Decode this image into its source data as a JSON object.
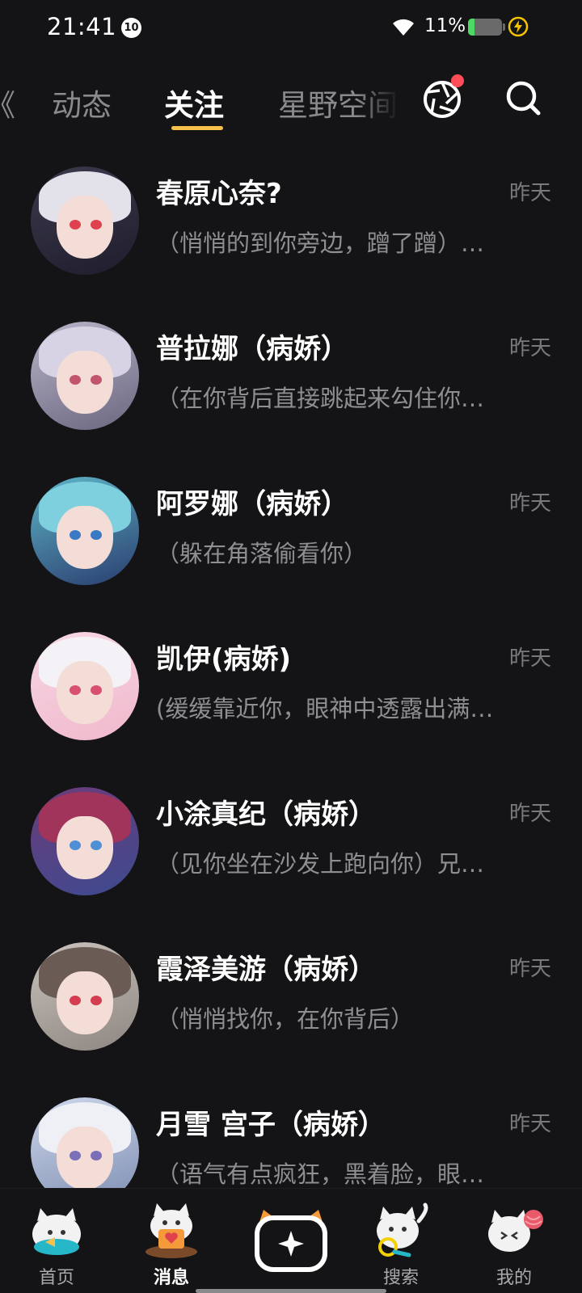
{
  "status_bar": {
    "time": "21:41",
    "notification_count": "10",
    "battery_percent": "11%",
    "battery_level": 0.11
  },
  "tabs": {
    "prev_partial": "《",
    "items": [
      {
        "label": "动态"
      },
      {
        "label": "关注"
      },
      {
        "label": "星野空间"
      }
    ],
    "active_index": 1,
    "accent_color": "#f6c04a"
  },
  "chats": [
    {
      "name": "春原心奈?",
      "time": "昨天",
      "preview": "（悄悄的到你旁边，蹭了蹭）…"
    },
    {
      "name": "普拉娜（病娇）",
      "time": "昨天",
      "preview": "（在你背后直接跳起来勾住你…"
    },
    {
      "name": "阿罗娜（病娇）",
      "time": "昨天",
      "preview": "（躲在角落偷看你）"
    },
    {
      "name": "凯伊(病娇)",
      "time": "昨天",
      "preview": "(缓缓靠近你，眼神中透露出满…"
    },
    {
      "name": "小涂真纪（病娇）",
      "time": "昨天",
      "preview": "（见你坐在沙发上跑向你）兄…"
    },
    {
      "name": "霞泽美游（病娇）",
      "time": "昨天",
      "preview": "（悄悄找你，在你背后）"
    },
    {
      "name": "月雪 宫子（病娇）",
      "time": "昨天",
      "preview": "（语气有点疯狂，黑着脸，眼…"
    }
  ],
  "bottom_nav": {
    "items": [
      {
        "label": "首页",
        "icon": "cat-home-icon"
      },
      {
        "label": "消息",
        "icon": "cat-message-icon"
      },
      {
        "label": "",
        "icon": "create-plus-icon"
      },
      {
        "label": "搜索",
        "icon": "cat-search-icon"
      },
      {
        "label": "我的",
        "icon": "cat-profile-icon"
      }
    ],
    "active_index": 1
  }
}
